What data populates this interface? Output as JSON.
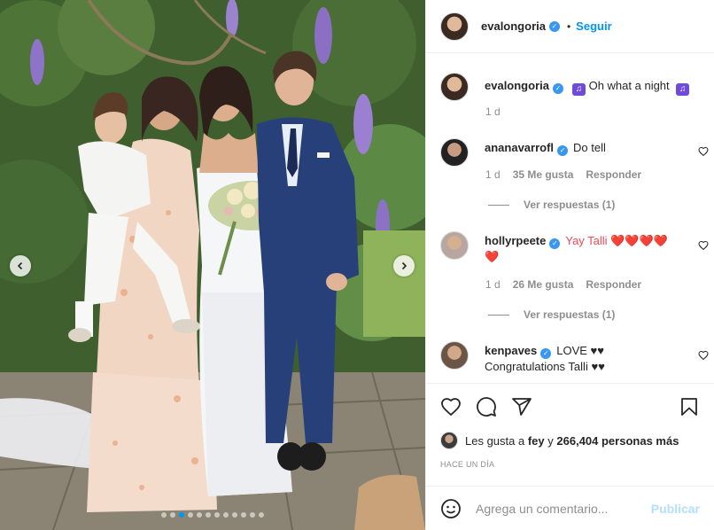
{
  "post": {
    "author": "evalongoria",
    "follow_label": "Seguir",
    "bullet": "•",
    "caption": "Oh what a night",
    "caption_age": "1 d",
    "image_count": 12,
    "active_image": 2
  },
  "comments": [
    {
      "user": "ananavarrofl",
      "verified": true,
      "text": "Do tell",
      "age": "1 d",
      "likes": "35 Me gusta",
      "reply": "Responder",
      "view_replies": "Ver respuestas (1)"
    },
    {
      "user": "hollyrpeete",
      "verified": true,
      "text": "Yay Talli ❤️❤️❤️❤️",
      "text_line2": "❤️",
      "age": "1 d",
      "likes": "26 Me gusta",
      "reply": "Responder",
      "view_replies": "Ver respuestas (1)"
    },
    {
      "user": "kenpaves",
      "verified": true,
      "text": "LOVE ♥♥",
      "text_line2": "Congratulations Talli ♥♥"
    }
  ],
  "likes": {
    "prefix": "Les gusta a",
    "first_user": "fey",
    "connector": "y",
    "others": "266,404 personas más"
  },
  "timestamp": "HACE UN DÍA",
  "comment_box": {
    "placeholder": "Agrega un comentario...",
    "publish_label": "Publicar"
  },
  "colors": {
    "accent": "#0095f6",
    "verified": "#3897f0",
    "muted": "#8e8e8e",
    "heart": "#ed4956",
    "publish_disabled": "#b2dffc"
  },
  "icons": [
    "chevron-left-icon",
    "chevron-right-icon",
    "verified-icon",
    "music-emoji-icon",
    "heart-icon",
    "comment-icon",
    "share-icon",
    "save-icon",
    "emoji-icon"
  ]
}
